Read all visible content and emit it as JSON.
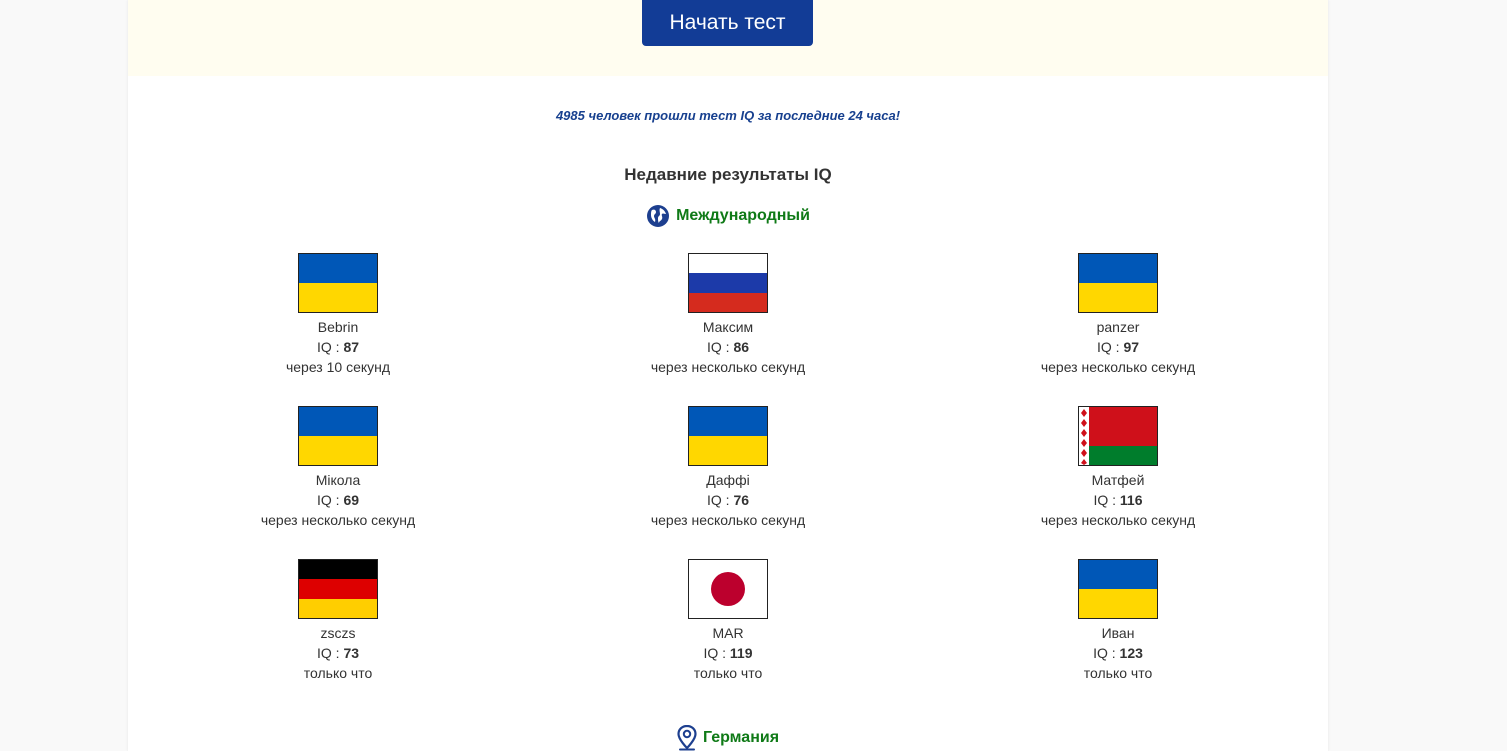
{
  "hero": {
    "start_button": "Начать тест"
  },
  "count_note": "4985 человек прошли тест IQ за последние 24 часа!",
  "section_title": "Недавние результаты IQ",
  "regions": {
    "international": "Международный",
    "germany": "Германия"
  },
  "iq_label": "IQ : ",
  "results": [
    {
      "flag": "ukraine",
      "name": "Bebrin",
      "iq": "87",
      "time": "через 10 секунд"
    },
    {
      "flag": "russia",
      "name": "Максим",
      "iq": "86",
      "time": "через несколько секунд"
    },
    {
      "flag": "ukraine",
      "name": "panzer",
      "iq": "97",
      "time": "через несколько секунд"
    },
    {
      "flag": "ukraine",
      "name": "Мiкола",
      "iq": "69",
      "time": "через несколько секунд"
    },
    {
      "flag": "ukraine",
      "name": "Даффі",
      "iq": "76",
      "time": "через несколько секунд"
    },
    {
      "flag": "belarus",
      "name": "Матфей",
      "iq": "116",
      "time": "через несколько секунд"
    },
    {
      "flag": "germany",
      "name": "zsczs",
      "iq": "73",
      "time": "только что"
    },
    {
      "flag": "japan",
      "name": "MAR",
      "iq": "119",
      "time": "только что"
    },
    {
      "flag": "ukraine",
      "name": "Иван",
      "iq": "123",
      "time": "только что"
    }
  ],
  "colors": {
    "button": "#123c96",
    "note": "#17408f",
    "region": "#0f7a17",
    "hero_bg": "#fffdf0"
  },
  "icons": {
    "international": "globe-icon",
    "germany": "map-pin-icon"
  }
}
